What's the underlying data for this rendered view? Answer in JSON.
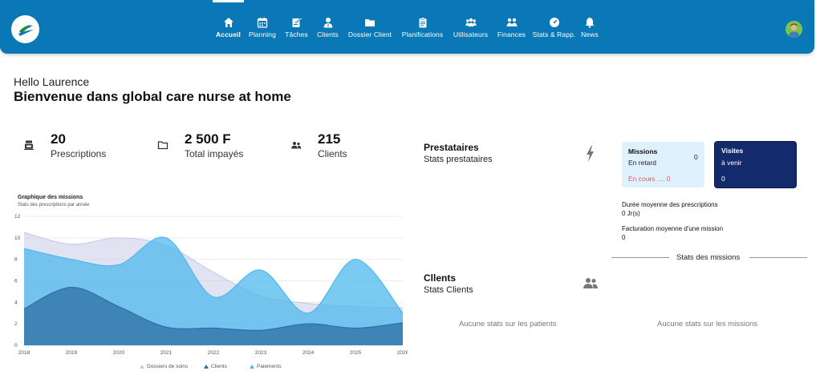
{
  "nav": {
    "items": [
      {
        "label": "Accueil",
        "icon": "home-icon",
        "active": true
      },
      {
        "label": "Planning",
        "icon": "calendar-icon"
      },
      {
        "label": "Tâches",
        "icon": "task-icon"
      },
      {
        "label": "Clients",
        "icon": "client-icon"
      },
      {
        "label": "Dossier Client",
        "icon": "folder-icon"
      },
      {
        "label": "Planifications",
        "icon": "clipboard-icon"
      },
      {
        "label": "Utilisateurs",
        "icon": "users-icon"
      },
      {
        "label": "Finances",
        "icon": "coins-icon"
      },
      {
        "label": "Stats & Rapp.",
        "icon": "gauge-icon"
      },
      {
        "label": "News",
        "icon": "bell-icon"
      }
    ],
    "bar_color": "#0a78b6"
  },
  "greeting": {
    "hello": "Hello Laurence",
    "welcome": "Bienvenue dans global care nurse at home"
  },
  "stats": {
    "prescriptions": {
      "value": "20",
      "label": "Prescriptions"
    },
    "impayes": {
      "value": "2 500 F",
      "label": "Total impayés"
    },
    "clients": {
      "value": "215",
      "label": "Clients"
    }
  },
  "chart": {
    "title": "Graphique des missions",
    "subtitle": "Stats des prescriptions par année"
  },
  "chart_data": {
    "type": "area",
    "x": [
      "2018",
      "2019",
      "2020",
      "2021",
      "2022",
      "2023",
      "2024",
      "2025",
      "2026"
    ],
    "ylim": [
      0,
      12
    ],
    "yticks": [
      "0",
      "2",
      "4",
      "6",
      "8",
      "10",
      "12"
    ],
    "grid": true,
    "legend_position": "bottom",
    "series": [
      {
        "name": "Dossiers de soins",
        "color": "#c9cce8",
        "values": [
          10.5,
          9.4,
          10,
          9.3,
          6.8,
          4.6,
          3.9,
          3.6,
          3.5
        ]
      },
      {
        "name": "Clients",
        "color": "#2c6fa3",
        "values": [
          3.4,
          5.4,
          3.6,
          1.7,
          1.6,
          1.4,
          2,
          1.6,
          2.1
        ]
      },
      {
        "name": "Paiements",
        "color": "#4fb8ee",
        "values": [
          9,
          8,
          7.5,
          10,
          4.5,
          7,
          3,
          8,
          3
        ]
      }
    ]
  },
  "prestataires": {
    "title": "Prestataires",
    "subtitle": "Stats prestataires",
    "icon": "bolt-icon"
  },
  "missions": {
    "title": "Missions",
    "count": "0",
    "late": "En retard",
    "in_progress": "En cours .... 0"
  },
  "visites": {
    "title": "Visites",
    "sub": "à venir",
    "count": "0"
  },
  "duree": {
    "label": "Durée moyenne des prescriptions",
    "value": "0 Jr(s)"
  },
  "facturation": {
    "label": "Facturation moyenne d'une mission",
    "value": "0"
  },
  "stats_missions": {
    "label": "Stats des missions",
    "empty": "Aucune stats sur les missions"
  },
  "clients_section": {
    "title": "Cllents",
    "subtitle": "Stats Clients",
    "icon": "users-icon",
    "empty": "Aucune stats sur les patients"
  }
}
